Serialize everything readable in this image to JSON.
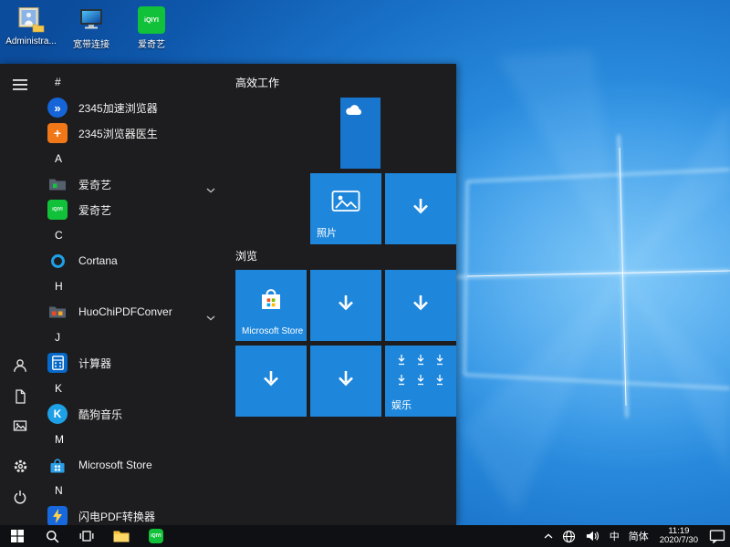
{
  "desktop": {
    "icons": [
      {
        "label": "Administra..."
      },
      {
        "label": "宽带连接"
      },
      {
        "label": "爱奇艺"
      }
    ]
  },
  "icons": {
    "speed_glyph": "»",
    "plus_glyph": "+",
    "kugou_glyph": "K",
    "iqiyi_wordmark": "iQIYI"
  },
  "start_menu": {
    "app_list": [
      {
        "kind": "header",
        "label": "#"
      },
      {
        "kind": "app",
        "label": "2345加速浏览器"
      },
      {
        "kind": "app",
        "label": "2345浏览器医生"
      },
      {
        "kind": "header",
        "label": "A"
      },
      {
        "kind": "group",
        "label": "爱奇艺"
      },
      {
        "kind": "app",
        "label": "爱奇艺"
      },
      {
        "kind": "header",
        "label": "C"
      },
      {
        "kind": "app",
        "label": "Cortana"
      },
      {
        "kind": "header",
        "label": "H"
      },
      {
        "kind": "group",
        "label": "HuoChiPDFConver"
      },
      {
        "kind": "header",
        "label": "J"
      },
      {
        "kind": "app",
        "label": "计算器"
      },
      {
        "kind": "header",
        "label": "K"
      },
      {
        "kind": "app",
        "label": "酷狗音乐"
      },
      {
        "kind": "header",
        "label": "M"
      },
      {
        "kind": "app",
        "label": "Microsoft Store"
      },
      {
        "kind": "header",
        "label": "N"
      },
      {
        "kind": "app",
        "label": "闪电PDF转换器"
      }
    ],
    "tile_groups": [
      {
        "title": "高效工作"
      },
      {
        "title": "浏览"
      }
    ],
    "tiles": {
      "photos_label": "照片",
      "store_label": "Microsoft Store",
      "entertainment_label": "娱乐"
    }
  },
  "tray": {
    "ime_mode": "中",
    "ime_lang": "简体",
    "time": "11:19",
    "date": "2020/7/30"
  }
}
